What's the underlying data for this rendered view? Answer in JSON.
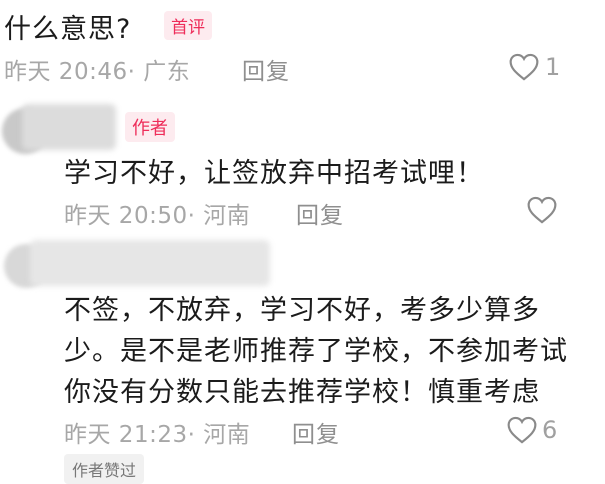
{
  "comment1": {
    "text": "什么意思?",
    "badge": "首评",
    "meta": "昨天 20:46· 广东",
    "reply": "回复",
    "likes": "1",
    "like_icon": "heart-outline-icon"
  },
  "reply1": {
    "badge": "作者",
    "text": "学习不好，让签放弃中招考试哩！",
    "meta": "昨天 20:50· 河南",
    "reply": "回复",
    "like_icon": "heart-outline-icon"
  },
  "reply2": {
    "lines": [
      "不签，不放弃，学习不好，考多少算多",
      "少。是不是老师推荐了学校，不参加考试",
      "你没有分数只能去推荐学校！慎重考虑"
    ],
    "meta": "昨天 21:23· 河南",
    "reply": "回复",
    "likes": "6",
    "like_icon": "heart-outline-icon",
    "author_liked": "作者赞过"
  },
  "colors": {
    "accent": "#ee2d5a",
    "meta_gray": "#a7a7a7"
  }
}
